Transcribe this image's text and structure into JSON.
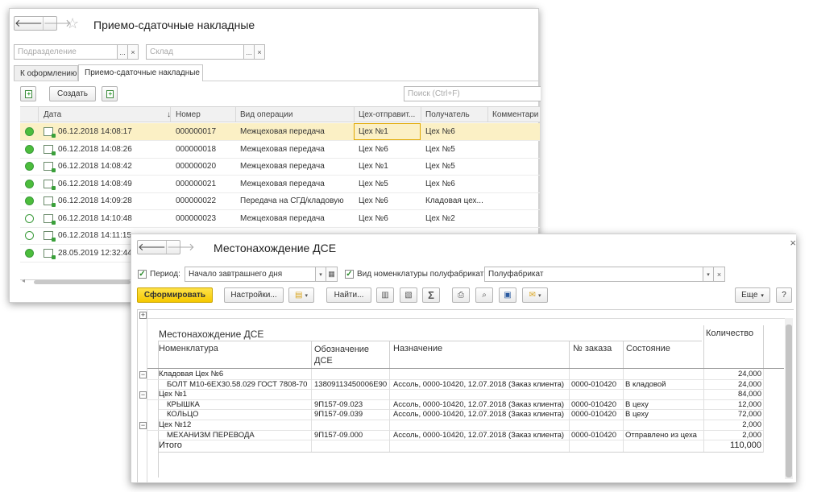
{
  "w1": {
    "nav": {
      "back": "🡐",
      "forward": "🡒"
    },
    "title": "Приемо-сдаточные накладные",
    "filters": {
      "dept_placeholder": "Подразделение",
      "warehouse_placeholder": "Склад",
      "dots": "...",
      "clear": "×"
    },
    "tabs": [
      "К оформлению",
      "Приемо-сдаточные накладные"
    ],
    "create_label": "Создать",
    "search_placeholder": "Поиск (Ctrl+F)",
    "columns": {
      "date": "Дата",
      "sort": "↓",
      "number": "Номер",
      "op": "Вид операции",
      "sender": "Цех-отправит...",
      "receiver": "Получатель",
      "comment": "Комментари"
    },
    "rows": [
      {
        "status": "posted",
        "date": "06.12.2018 14:08:17",
        "number": "000000017",
        "op": "Межцеховая передача",
        "sender": "Цех №1",
        "receiver": "Цех №6"
      },
      {
        "status": "posted",
        "date": "06.12.2018 14:08:26",
        "number": "000000018",
        "op": "Межцеховая передача",
        "sender": "Цех №6",
        "receiver": "Цех №5"
      },
      {
        "status": "posted",
        "date": "06.12.2018 14:08:42",
        "number": "000000020",
        "op": "Межцеховая передача",
        "sender": "Цех №1",
        "receiver": "Цех №5"
      },
      {
        "status": "posted",
        "date": "06.12.2018 14:08:49",
        "number": "000000021",
        "op": "Межцеховая передача",
        "sender": "Цех №5",
        "receiver": "Цех №6"
      },
      {
        "status": "posted",
        "date": "06.12.2018 14:09:28",
        "number": "000000022",
        "op": "Передача на СГД/кладовую",
        "sender": "Цех №6",
        "receiver": "Кладовая цех..."
      },
      {
        "status": "draft",
        "date": "06.12.2018 14:10:48",
        "number": "000000023",
        "op": "Межцеховая передача",
        "sender": "Цех №6",
        "receiver": "Цех №2"
      },
      {
        "status": "draft",
        "date": "06.12.2018 14:11:15",
        "number": "",
        "op": "",
        "sender": "",
        "receiver": ""
      },
      {
        "status": "posted",
        "date": "28.05.2019 12:32:44",
        "number": "",
        "op": "",
        "sender": "",
        "receiver": ""
      }
    ]
  },
  "w2": {
    "nav": {
      "back": "🡐",
      "forward": "🡒"
    },
    "title": "Местонахождение ДСЕ",
    "close": "×",
    "period_label": "Период:",
    "period_value": "Начало завтрашнего дня",
    "nomen_label": "Вид номенклатуры полуфабрикат:",
    "nomen_value": "Полуфабрикат",
    "form_label": "Сформировать",
    "settings_label": "Настройки...",
    "find_label": "Найти...",
    "sigma": "Σ",
    "more_label": "Еще",
    "help_label": "?",
    "report": {
      "heading": "Местонахождение ДСЕ",
      "qty_header": "Количество",
      "col_nomen": "Номенклатура",
      "col_designation": "Обозначение ДСЕ",
      "col_purpose": "Назначение",
      "col_order": "№ заказа",
      "col_state": "Состояние",
      "groups": [
        {
          "name": "Кладовая Цех №6",
          "qty": "24,000",
          "items": [
            {
              "name": "БОЛТ М10-6ЕХ30.58.029 ГОСТ 7808-70",
              "designation": "13809113450006Е90",
              "purpose": "Ассоль, 0000-10420, 12.07.2018 (Заказ клиента)",
              "order": "0000-010420",
              "state": "В кладовой",
              "qty": "24,000"
            }
          ]
        },
        {
          "name": "Цех №1",
          "qty": "84,000",
          "items": [
            {
              "name": "КРЫШКА",
              "designation": "9П157-09.023",
              "purpose": "Ассоль, 0000-10420, 12.07.2018 (Заказ клиента)",
              "order": "0000-010420",
              "state": "В цеху",
              "qty": "12,000"
            },
            {
              "name": "КОЛЬЦО",
              "designation": "9П157-09.039",
              "purpose": "Ассоль, 0000-10420, 12.07.2018 (Заказ клиента)",
              "order": "0000-010420",
              "state": "В цеху",
              "qty": "72,000"
            }
          ]
        },
        {
          "name": "Цех №12",
          "qty": "2,000",
          "items": [
            {
              "name": "МЕХАНИЗМ ПЕРЕВОДА",
              "designation": "9П157-09.000",
              "purpose": "Ассоль, 0000-10420, 12.07.2018 (Заказ клиента)",
              "order": "0000-010420",
              "state": "Отправлено из цеха",
              "qty": "2,000"
            }
          ]
        }
      ],
      "total_label": "Итого",
      "total_qty": "110,000"
    }
  }
}
